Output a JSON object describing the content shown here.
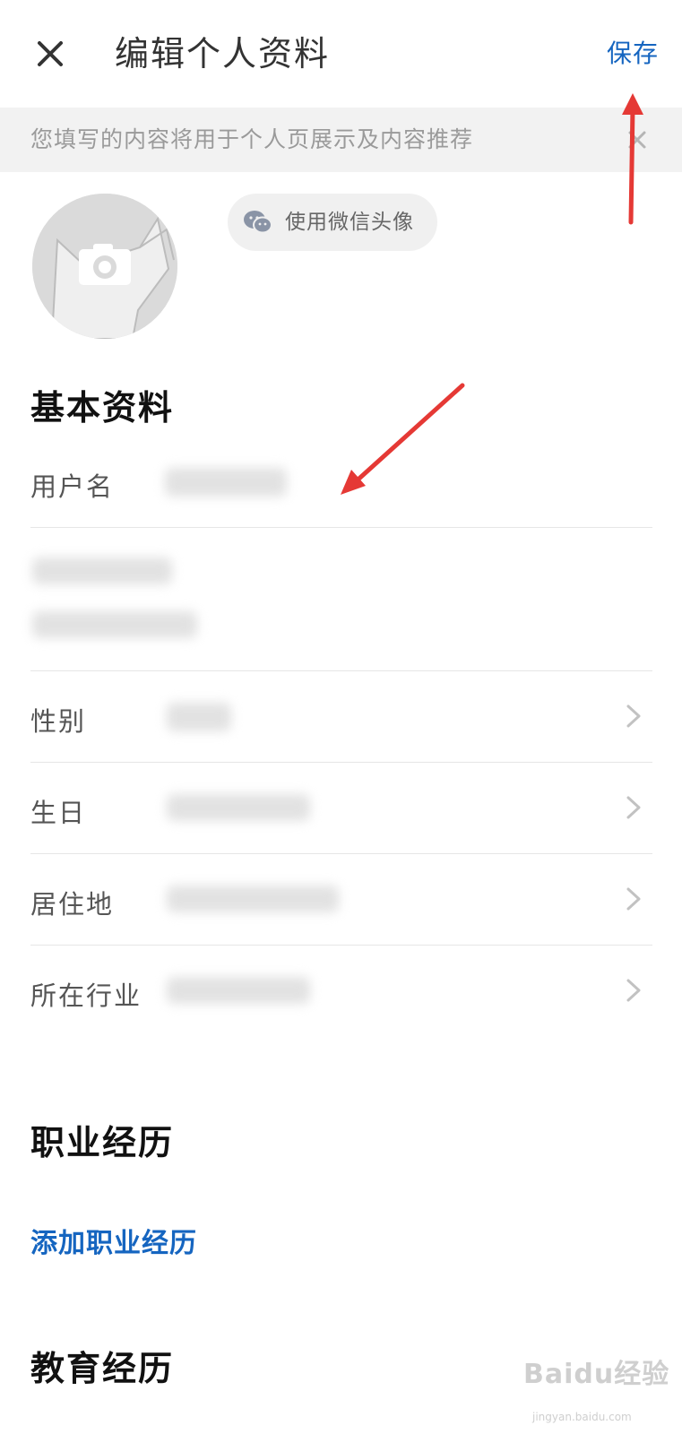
{
  "header": {
    "title": "编辑个人资料",
    "save_label": "保存"
  },
  "notice": {
    "text": "您填写的内容将用于个人页展示及内容推荐"
  },
  "avatar": {
    "wechat_button_label": "使用微信头像"
  },
  "basic_info": {
    "title": "基本资料",
    "username_label": "用户名",
    "gender_label": "性别",
    "birthday_label": "生日",
    "residence_label": "居住地",
    "industry_label": "所在行业"
  },
  "career": {
    "title": "职业经历",
    "add_label": "添加职业经历"
  },
  "education": {
    "title": "教育经历"
  },
  "watermark": {
    "text": "Baidu经验",
    "sub": "jingyan.baidu.com"
  },
  "colors": {
    "accent": "#1565c0",
    "annotation_arrow": "#e53935"
  }
}
